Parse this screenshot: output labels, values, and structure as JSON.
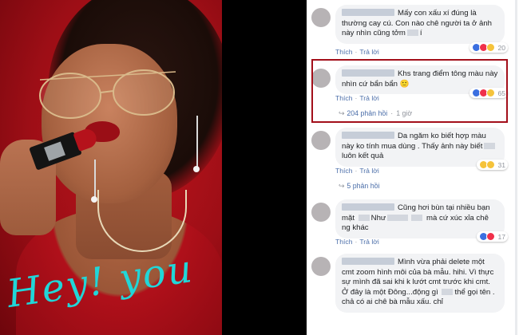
{
  "photo": {
    "overlay_text": "Hey! you"
  },
  "comments": [
    {
      "text": "Mấy con xấu xí đúng là thường cay cú. Con nào chê người ta ở ảnh này nhìn cũng tởm",
      "text_tail": "í",
      "like": "Thích",
      "reply": "Trả lời",
      "reaction_count": "20",
      "reactions": [
        "like",
        "love",
        "haha"
      ]
    },
    {
      "text": "Khs trang điểm tông màu này nhìn cứ bẩn bẩn",
      "emoji": "🙂",
      "like": "Thích",
      "reply": "Trả lời",
      "reaction_count": "65",
      "reactions": [
        "like",
        "love",
        "haha"
      ],
      "replies_label": "204 phản hồi",
      "time": "1 giờ"
    },
    {
      "text": "Da ngăm ko biết hợp màu này ko tính mua dùng . Thấy ảnh này biết",
      "text_tail": "luôn kết quả",
      "like": "Thích",
      "reply": "Trả lời",
      "reaction_count": "31",
      "reactions": [
        "haha",
        "sad"
      ],
      "replies_label": "5 phản hồi"
    },
    {
      "text": "Cũng hơi bùn tại nhiều bạn mặt",
      "text_mid": "Như",
      "text_tail": "mà cứ xúc xỉa chê ng khác",
      "like": "Thích",
      "reply": "Trả lời",
      "reaction_count": "17",
      "reactions": [
        "like",
        "love"
      ]
    },
    {
      "text": "Mình vừa phải delete một cmt zoom hình môi của bà mẫu. hihi. Vì thực sự mình đã sai khi k lướt cmt trước khi cmt. Ở đây là một Đông...động gì",
      "text_tail": "thể gọi tên .",
      "text_end": "chả có ai chê bà mẫu xấu. chỉ"
    }
  ],
  "colors": {
    "link": "#4b6ea9",
    "bubble": "#f2f3f5",
    "highlight_border": "#a30f1a",
    "hey_text": "#21d6d8"
  }
}
